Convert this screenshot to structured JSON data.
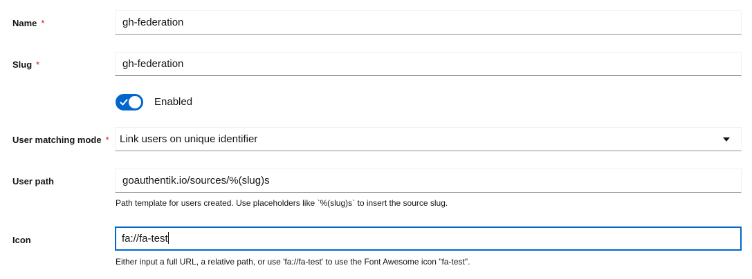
{
  "name": {
    "label": "Name",
    "required_mark": "*",
    "value": "gh-federation"
  },
  "slug": {
    "label": "Slug",
    "required_mark": "*",
    "value": "gh-federation"
  },
  "enabled": {
    "label": "Enabled",
    "checked": true,
    "icon": "check-icon"
  },
  "user_matching_mode": {
    "label": "User matching mode",
    "required_mark": "*",
    "selected": "Link users on unique identifier",
    "icon": "caret-down-icon"
  },
  "user_path": {
    "label": "User path",
    "value": "goauthentik.io/sources/%(slug)s",
    "helper": "Path template for users created. Use placeholders like `%(slug)s` to insert the source slug."
  },
  "icon": {
    "label": "Icon",
    "value": "fa://fa-test",
    "helper": "Either input a full URL, a relative path, or use 'fa://fa-test' to use the Font Awesome icon \"fa-test\"."
  },
  "colors": {
    "accent": "#0066cc",
    "required": "#c9190b",
    "text": "#151515",
    "input_border": "#8a8d90"
  }
}
